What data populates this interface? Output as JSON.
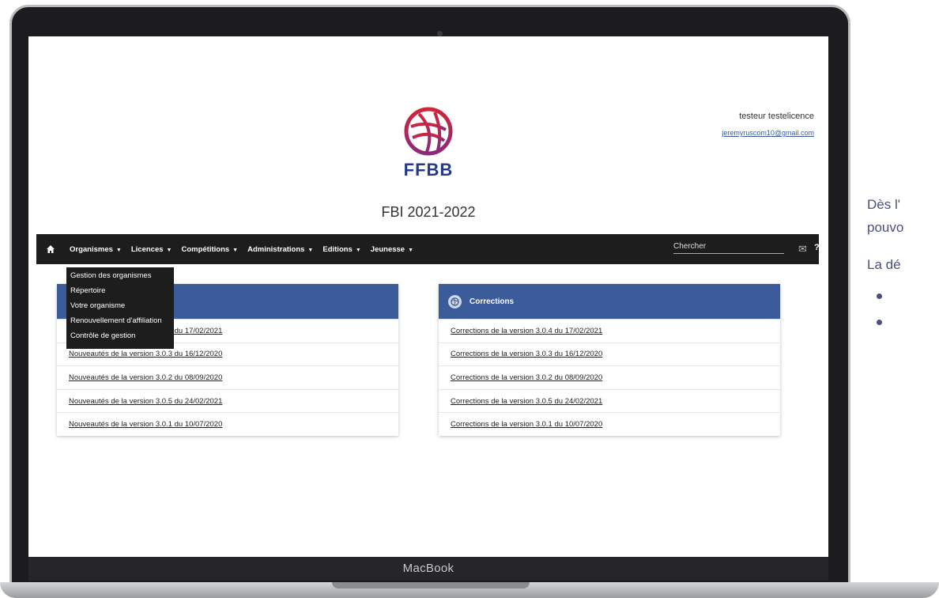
{
  "device": {
    "chin_label": "MacBook"
  },
  "user": {
    "name": "testeur testelicence",
    "email": "jeremyruscom10@gmail.com"
  },
  "logo": {
    "text": "FFBB",
    "colors": {
      "ball": "#c6253f",
      "text": "#263a8a"
    }
  },
  "app_title": "FBI 2021-2022",
  "navbar": {
    "items": [
      {
        "label": "Organismes"
      },
      {
        "label": "Licences"
      },
      {
        "label": "Compétitions"
      },
      {
        "label": "Administrations"
      },
      {
        "label": "Editions"
      },
      {
        "label": "Jeunesse"
      }
    ],
    "search_placeholder": "Chercher",
    "help_label": "?"
  },
  "dropdown": {
    "items": [
      {
        "label": "Gestion des organismes"
      },
      {
        "label": "Répertoire"
      },
      {
        "label": "Votre organisme"
      },
      {
        "label": "Renouvellement d'affiliation"
      },
      {
        "label": "Contrôle de gestion"
      }
    ]
  },
  "news_card": {
    "rows": [
      {
        "label": "Nouveautés de la version 3.0.4 du 17/02/2021"
      },
      {
        "label": "Nouveautés de la version 3.0.3 du 16/12/2020"
      },
      {
        "label": "Nouveautés de la version 3.0.2 du 08/09/2020"
      },
      {
        "label": "Nouveautés de la version 3.0.5 du 24/02/2021"
      },
      {
        "label": "Nouveautés de la version 3.0.1 du 10/07/2020"
      }
    ]
  },
  "corrections_card": {
    "title": "Corrections",
    "rows": [
      {
        "label": "Corrections de la version 3.0.4 du 17/02/2021"
      },
      {
        "label": "Corrections de la version 3.0.3 du 16/12/2020"
      },
      {
        "label": "Corrections de la version 3.0.2 du 08/09/2020"
      },
      {
        "label": "Corrections de la version 3.0.5 du 24/02/2021"
      },
      {
        "label": "Corrections de la version 3.0.1 du 10/07/2020"
      }
    ]
  },
  "side_text": {
    "line1": "Dès l'",
    "line2": "pouvo",
    "line3": "La dé",
    "bullets": [
      "",
      ""
    ]
  },
  "theme": {
    "navbar": "#1d1d1d",
    "card_header": "#3b5b9a"
  }
}
